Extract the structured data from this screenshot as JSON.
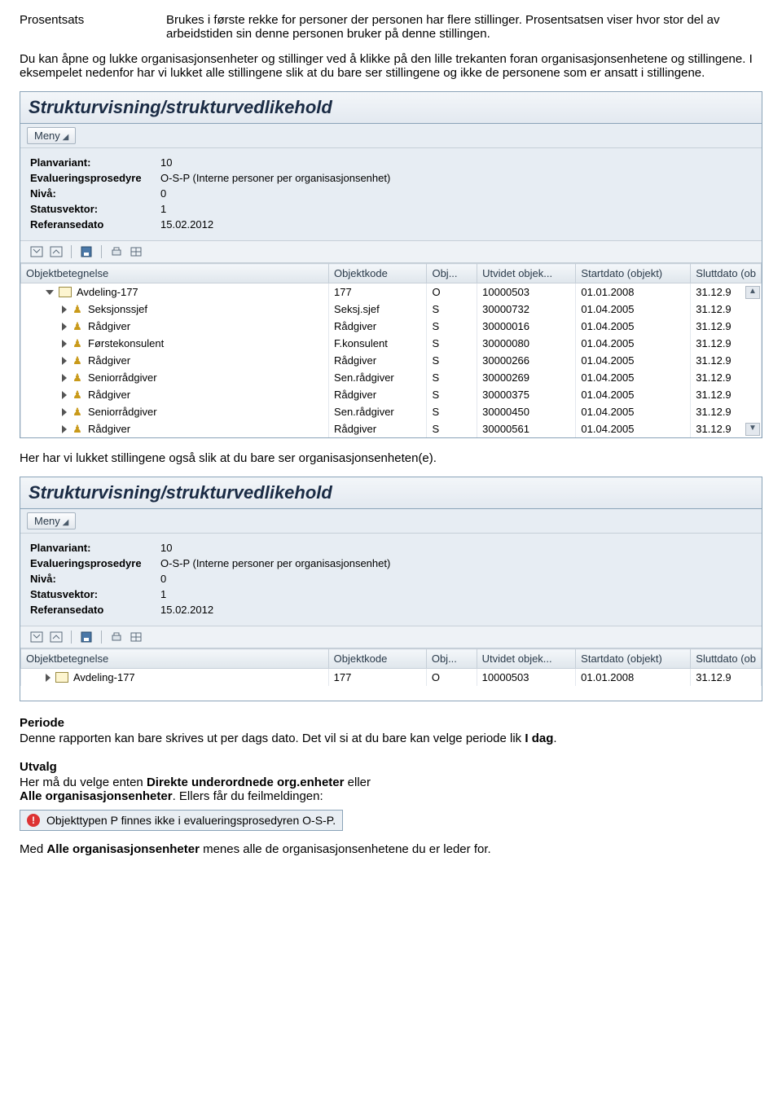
{
  "def": {
    "term": "Prosentsats",
    "body": "Brukes i første rekke for personer der personen har flere stillinger. Prosentsatsen viser hvor stor del av arbeidstiden sin denne personen bruker på denne stillingen."
  },
  "para1": "Du kan åpne og lukke organisasjonsenheter og stillinger ved å klikke på den lille trekanten foran organisasjonsenhetene og stillingene. I eksempelet nedenfor har vi lukket alle stillingene slik at du bare ser stillingene og ikke de personene som er ansatt i stillingene.",
  "sap": {
    "title": "Strukturvisning/strukturvedlikehold",
    "menu": "Meny",
    "info": {
      "planvariant_label": "Planvariant:",
      "planvariant": "10",
      "eval_label": "Evalueringsprosedyre",
      "eval": "O-S-P (Interne personer per organisasjonsenhet)",
      "niva_label": "Nivå:",
      "niva": "0",
      "status_label": "Statusvektor:",
      "status": "1",
      "refdato_label": "Referansedato",
      "refdato": "15.02.2012"
    },
    "cols": {
      "obj": "Objektbetegnelse",
      "code": "Objektkode",
      "ot": "Obj...",
      "ext": "Utvidet objek...",
      "start": "Startdato (objekt)",
      "end": "Sluttdato (ob"
    },
    "rows": [
      {
        "indent": 1,
        "expander": "down",
        "icon": "folder",
        "label": "Avdeling-177",
        "code": "177",
        "ot": "O",
        "ext": "10000503",
        "start": "01.01.2008",
        "end": "31.12.9"
      },
      {
        "indent": 2,
        "expander": "right",
        "icon": "person",
        "label": "Seksjonssjef",
        "code": "Seksj.sjef",
        "ot": "S",
        "ext": "30000732",
        "start": "01.04.2005",
        "end": "31.12.9"
      },
      {
        "indent": 2,
        "expander": "right",
        "icon": "person",
        "label": "Rådgiver",
        "code": "Rådgiver",
        "ot": "S",
        "ext": "30000016",
        "start": "01.04.2005",
        "end": "31.12.9"
      },
      {
        "indent": 2,
        "expander": "right",
        "icon": "person",
        "label": "Førstekonsulent",
        "code": "F.konsulent",
        "ot": "S",
        "ext": "30000080",
        "start": "01.04.2005",
        "end": "31.12.9"
      },
      {
        "indent": 2,
        "expander": "right",
        "icon": "person",
        "label": "Rådgiver",
        "code": "Rådgiver",
        "ot": "S",
        "ext": "30000266",
        "start": "01.04.2005",
        "end": "31.12.9"
      },
      {
        "indent": 2,
        "expander": "right",
        "icon": "person",
        "label": "Seniorrådgiver",
        "code": "Sen.rådgiver",
        "ot": "S",
        "ext": "30000269",
        "start": "01.04.2005",
        "end": "31.12.9"
      },
      {
        "indent": 2,
        "expander": "right",
        "icon": "person",
        "label": "Rådgiver",
        "code": "Rådgiver",
        "ot": "S",
        "ext": "30000375",
        "start": "01.04.2005",
        "end": "31.12.9"
      },
      {
        "indent": 2,
        "expander": "right",
        "icon": "person",
        "label": "Seniorrådgiver",
        "code": "Sen.rådgiver",
        "ot": "S",
        "ext": "30000450",
        "start": "01.04.2005",
        "end": "31.12.9"
      },
      {
        "indent": 2,
        "expander": "right",
        "icon": "person",
        "label": "Rådgiver",
        "code": "Rådgiver",
        "ot": "S",
        "ext": "30000561",
        "start": "01.04.2005",
        "end": "31.12.9"
      }
    ],
    "rows2": [
      {
        "indent": 1,
        "expander": "right",
        "icon": "folder",
        "label": "Avdeling-177",
        "code": "177",
        "ot": "O",
        "ext": "10000503",
        "start": "01.01.2008",
        "end": "31.12.9"
      }
    ]
  },
  "para2": "Her har vi lukket stillingene også slik at du bare ser organisasjonsenheten(e).",
  "periode": {
    "heading": "Periode",
    "body_a": "Denne rapporten kan bare skrives ut per dags dato. Det vil si at du bare kan velge periode lik ",
    "body_b": "I dag",
    "body_c": "."
  },
  "utvalg": {
    "heading": "Utvalg",
    "line1_a": "Her må du velge enten ",
    "line1_b": "Direkte underordnede org.enheter",
    "line1_c": " eller",
    "line2_a": "Alle organisasjonsenheter",
    "line2_b": ". Ellers får du feilmeldingen:"
  },
  "error": "Objekttypen P finnes ikke i evalueringsprosedyren O-S-P.",
  "footer_a": "Med ",
  "footer_b": "Alle organisasjonsenheter",
  "footer_c": " menes alle de organisasjonsenhetene du er leder for."
}
